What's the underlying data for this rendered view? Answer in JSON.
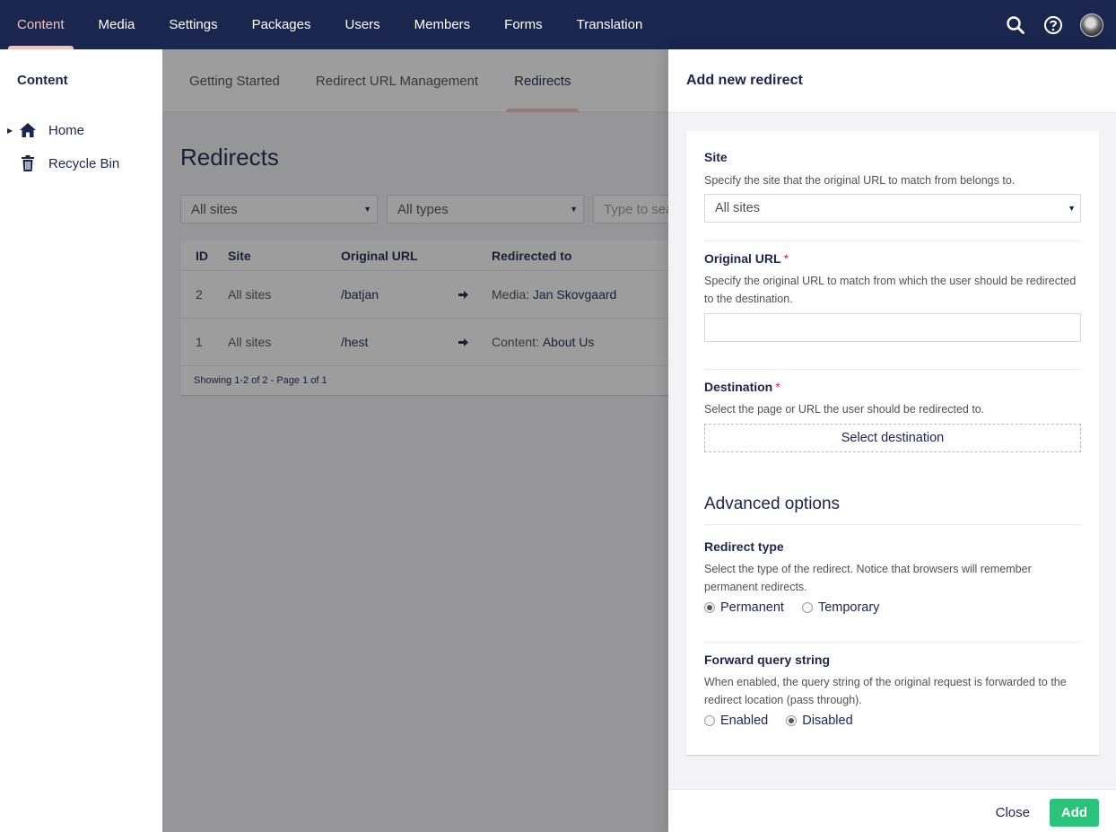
{
  "topnav": {
    "items": [
      "Content",
      "Media",
      "Settings",
      "Packages",
      "Users",
      "Members",
      "Forms",
      "Translation"
    ],
    "active": "Content"
  },
  "tree": {
    "title": "Content",
    "items": [
      {
        "label": "Home",
        "icon": "home-icon"
      },
      {
        "label": "Recycle Bin",
        "icon": "trash-icon"
      }
    ]
  },
  "subtabs": [
    "Getting Started",
    "Redirect URL Management",
    "Redirects"
  ],
  "page": {
    "title": "Redirects",
    "filters": {
      "site": "All sites",
      "type": "All types",
      "search_placeholder": "Type to search"
    }
  },
  "table": {
    "headers": [
      "ID",
      "Site",
      "Original URL",
      "Redirected to"
    ],
    "rows": [
      {
        "id": "2",
        "site": "All sites",
        "url": "/batjan",
        "dest_type": "Media:",
        "dest_name": "Jan Skovgaard"
      },
      {
        "id": "1",
        "site": "All sites",
        "url": "/hest",
        "dest_type": "Content:",
        "dest_name": "About Us"
      }
    ],
    "footer": "Showing 1-2 of 2 - Page 1 of 1"
  },
  "panel": {
    "title": "Add new redirect",
    "site": {
      "label": "Site",
      "desc": "Specify the site that the original URL to match from belongs to.",
      "value": "All sites"
    },
    "original": {
      "label": "Original URL",
      "required": "*",
      "desc": "Specify the original URL to match from which the user should be redirected to the destination.",
      "value": ""
    },
    "destination": {
      "label": "Destination",
      "required": "*",
      "desc": "Select the page or URL the user should be redirected to.",
      "button": "Select destination"
    },
    "advanced_title": "Advanced options",
    "redirect_type": {
      "label": "Redirect type",
      "desc": "Select the type of the redirect. Notice that browsers will remember permanent redirects.",
      "options": [
        "Permanent",
        "Temporary"
      ],
      "selected": "Permanent"
    },
    "forward": {
      "label": "Forward query string",
      "desc": "When enabled, the query string of the original request is forwarded to the redirect location (pass through).",
      "options": [
        "Enabled",
        "Disabled"
      ],
      "selected": "Disabled"
    },
    "close": "Close",
    "add": "Add"
  },
  "colors": {
    "nav_bg": "#1b264f",
    "accent": "#f5c1bc",
    "add_button": "#2bc37c",
    "required": "#d42054"
  }
}
